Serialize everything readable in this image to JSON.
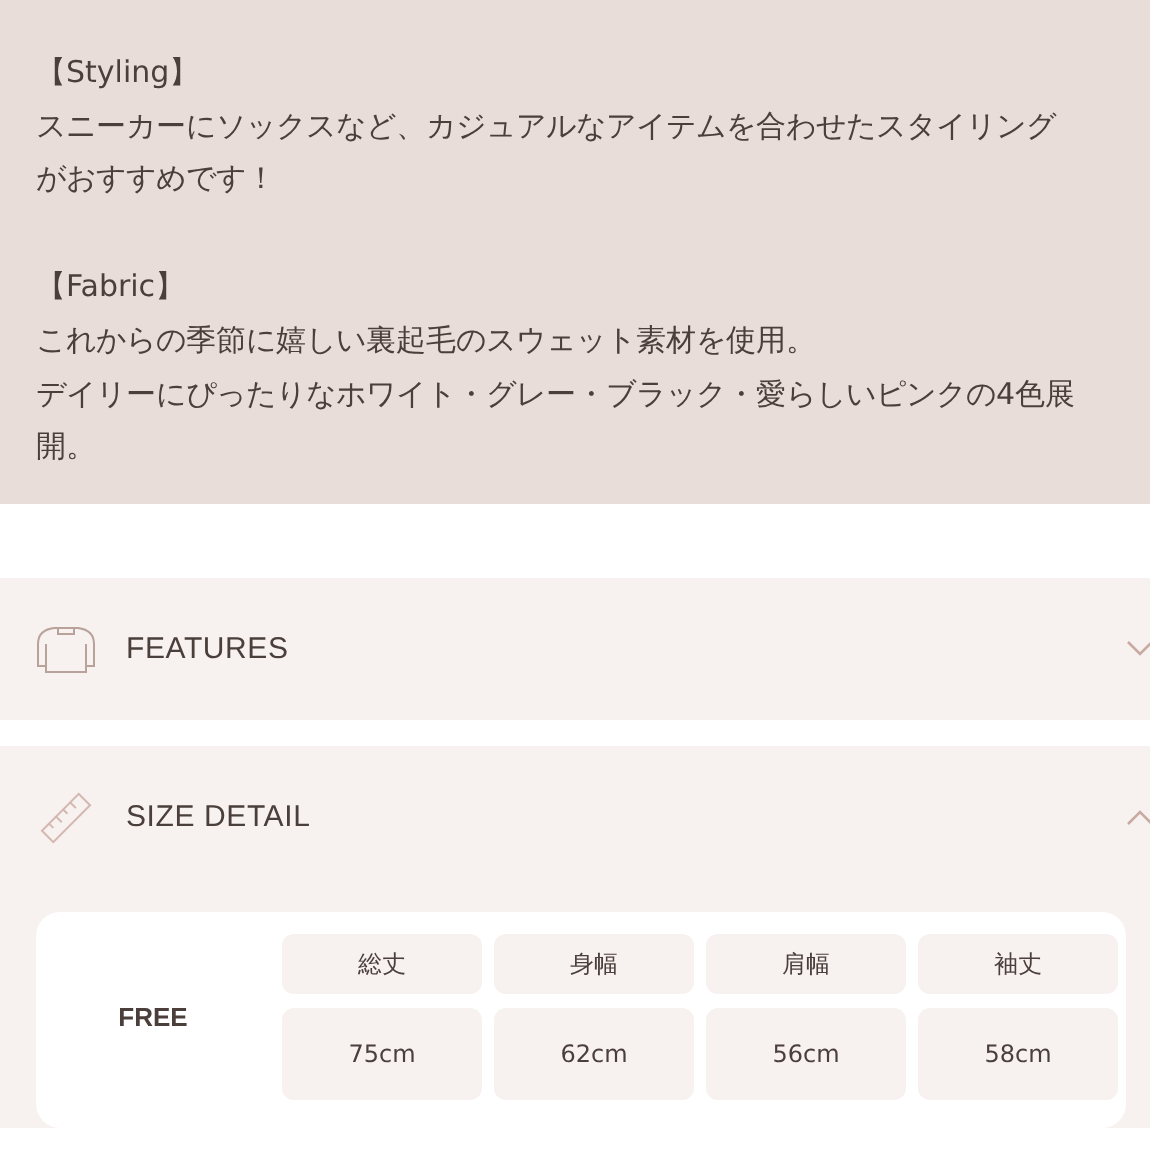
{
  "description": {
    "blocks": [
      {
        "heading": "【Styling】",
        "lines": [
          "スニーカーにソックスなど、カジュアルなアイテムを合わせたスタイリング",
          "がおすすめです！"
        ]
      },
      {
        "heading": "【Fabric】",
        "lines": [
          "これからの季節に嬉しい裏起毛のスウェット素材を使用。",
          "デイリーにぴったりなホワイト・グレー・ブラック・愛らしいピンクの4色展",
          "開。"
        ]
      }
    ]
  },
  "sections": [
    {
      "kind": "features",
      "title": "FEATURES",
      "expanded": false
    },
    {
      "kind": "size",
      "title": "SIZE DETAIL",
      "expanded": true,
      "size_table": {
        "size": "FREE",
        "columns": [
          "総丈",
          "身幅",
          "肩幅",
          "袖丈"
        ],
        "values": [
          "75cm",
          "62cm",
          "56cm",
          "58cm"
        ]
      }
    }
  ]
}
